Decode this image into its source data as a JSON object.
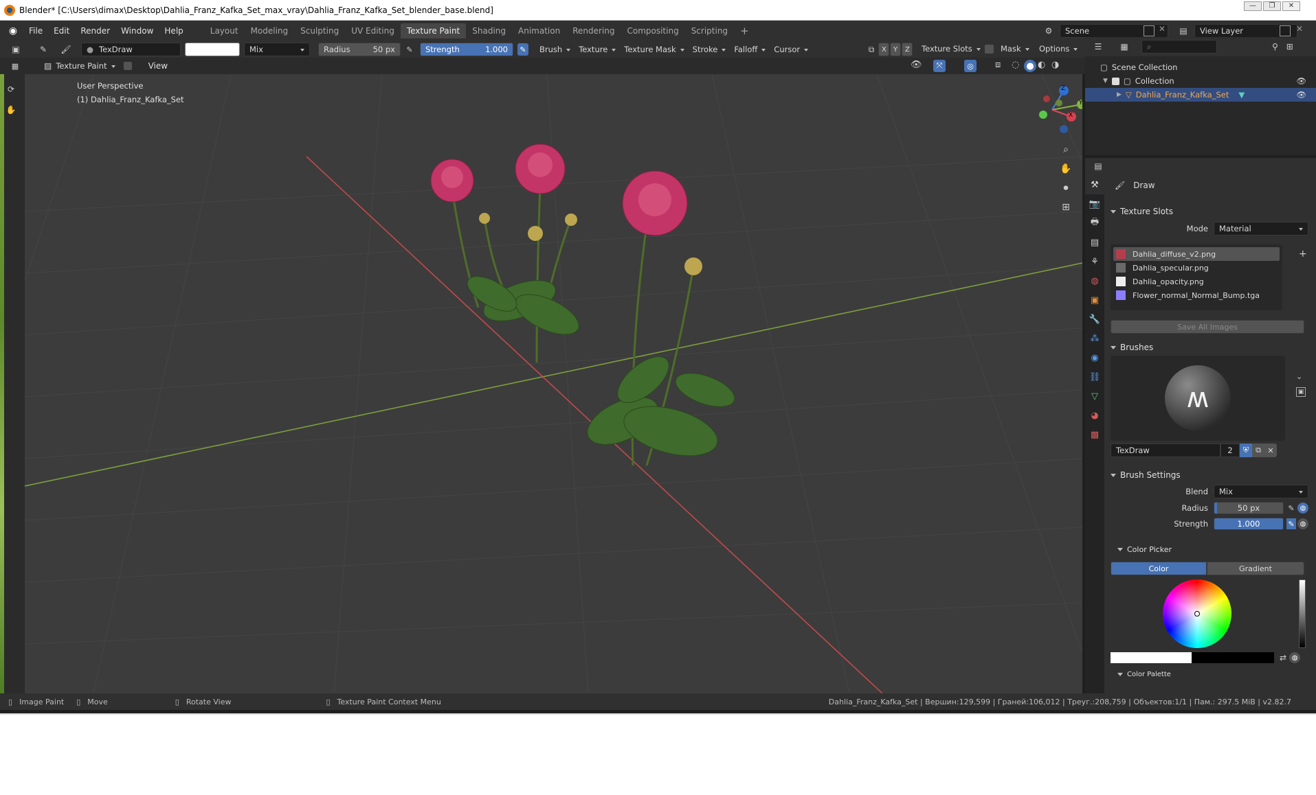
{
  "window": {
    "title": "Blender* [C:\\Users\\dimax\\Desktop\\Dahlia_Franz_Kafka_Set_max_vray\\Dahlia_Franz_Kafka_Set_blender_base.blend]",
    "min": "—",
    "max": "❐",
    "close": "✕"
  },
  "menubar": {
    "menus": [
      "File",
      "Edit",
      "Render",
      "Window",
      "Help"
    ],
    "workspaces": [
      "Layout",
      "Modeling",
      "Sculpting",
      "UV Editing",
      "Texture Paint",
      "Shading",
      "Animation",
      "Rendering",
      "Compositing",
      "Scripting"
    ],
    "active_workspace": "Texture Paint",
    "add_tab": "+",
    "scene_label": "Scene",
    "view_layer_label": "View Layer"
  },
  "tool_header": {
    "brush_name": "TexDraw",
    "blend": "Mix",
    "radius_label": "Radius",
    "radius_value": "50 px",
    "strength_label": "Strength",
    "strength_value": "1.000",
    "menus": [
      "Brush",
      "Texture",
      "Texture Mask",
      "Stroke",
      "Falloff",
      "Cursor"
    ],
    "axes": [
      "X",
      "Y",
      "Z"
    ],
    "texture_slots": "Texture Slots",
    "mask": "Mask",
    "options": "Options"
  },
  "viewport_header": {
    "mode": "Texture Paint",
    "view": "View"
  },
  "viewport": {
    "perspective": "User Perspective",
    "object_label": "(1) Dahlia_Franz_Kafka_Set",
    "gizmo": {
      "x": "X",
      "y": "Y",
      "z": "Z"
    },
    "colors": {
      "background": "#3c3c3c",
      "x_axis": "#c24a4a",
      "y_axis": "#7ea03c"
    }
  },
  "outliner": {
    "root": "Scene Collection",
    "collection": "Collection",
    "object": "Dahlia_Franz_Kafka_Set"
  },
  "properties": {
    "tool_name": "Draw",
    "texture_slots": {
      "title": "Texture Slots",
      "mode_label": "Mode",
      "mode_value": "Material",
      "slots": [
        {
          "name": "Dahlia_diffuse_v2.png",
          "color": "#b63d4e"
        },
        {
          "name": "Dahlia_specular.png",
          "color": "#6a6a6a"
        },
        {
          "name": "Dahlia_opacity.png",
          "color": "#eeeeee"
        },
        {
          "name": "Flower_normal_Normal_Bump.tga",
          "color": "#8a7eff"
        }
      ],
      "save_all": "Save All Images"
    },
    "brushes": {
      "title": "Brushes",
      "brush_name": "TexDraw",
      "users": "2"
    },
    "brush_settings": {
      "title": "Brush Settings",
      "blend_label": "Blend",
      "blend_value": "Mix",
      "radius_label": "Radius",
      "radius_value": "50 px",
      "strength_label": "Strength",
      "strength_value": "1.000"
    },
    "color_picker": {
      "title": "Color Picker",
      "tab_color": "Color",
      "tab_gradient": "Gradient"
    },
    "color_palette_title": "Color Palette"
  },
  "statusbar": {
    "left": [
      "Image Paint",
      "Move",
      "Rotate View",
      "Texture Paint Context Menu"
    ],
    "stats": "Dahlia_Franz_Kafka_Set | Вершин:129,599 | Граней:106,012 | Треуг.:208,759 | Объектов:1/1 | Пам.: 297.5 MiB | v2.82.7"
  },
  "accent": "#4772b3"
}
